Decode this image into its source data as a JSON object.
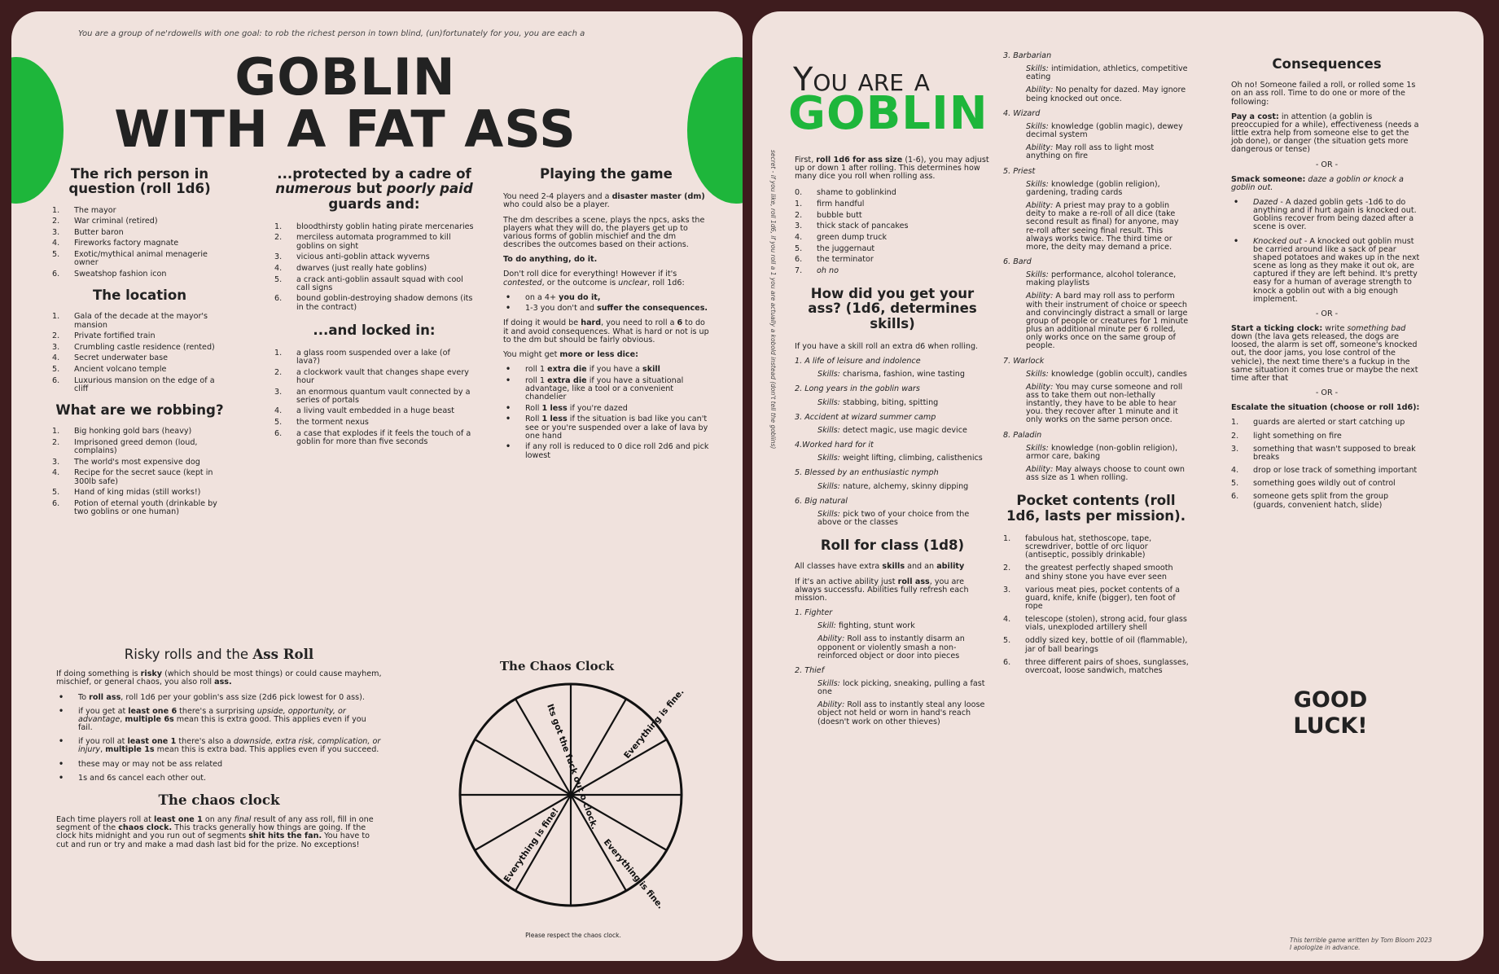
{
  "page1": {
    "intro": "You are a group of ne'rdowells with one goal: to rob the richest person in town blind, (un)fortunately for you, you are each a",
    "title_line1": "GOBLIN",
    "title_line2": "WITH A FAT ASS",
    "rich": {
      "heading": "The rich person in question (roll 1d6)",
      "items": [
        "The mayor",
        "War criminal (retired)",
        "Butter baron",
        "Fireworks factory magnate",
        "Exotic/mythical animal menagerie owner",
        "Sweatshop fashion icon"
      ]
    },
    "location": {
      "heading": "The location",
      "items": [
        "Gala of the decade at the mayor's mansion",
        "Private fortified train",
        "Crumbling castle residence (rented)",
        "Secret underwater base",
        "Ancient volcano temple",
        "Luxurious mansion on the edge of a cliff"
      ]
    },
    "robbing": {
      "heading": "What are we robbing?",
      "items": [
        "Big honking gold bars (heavy)",
        "Imprisoned greed demon (loud, complains)",
        "The world's most expensive dog",
        "Recipe for the secret sauce (kept in 300lb safe)",
        "Hand of king midas (still works!)",
        "Potion of eternal youth (drinkable by two goblins or one human)"
      ]
    },
    "protected": {
      "heading_a": "...protected by a cadre of",
      "heading_b1": "numerous",
      "heading_b2": " but ",
      "heading_b3": "poorly paid",
      "heading_c": "guards and:",
      "items": [
        "bloodthirsty goblin hating pirate mercenaries",
        "merciless automata programmed to kill goblins on sight",
        "vicious anti-goblin attack wyverns",
        "dwarves (just really hate goblins)",
        "a crack anti-goblin assault squad with cool call signs",
        "bound goblin-destroying shadow demons (its in the contract)"
      ]
    },
    "locked": {
      "heading": "...and locked in:",
      "items": [
        "a glass room suspended over a lake (of lava?)",
        "a clockwork vault that changes shape every hour",
        "an enormous quantum vault connected by a series of portals",
        "a living vault embedded in a huge beast",
        "the torment nexus",
        "a case that explodes if it feels the touch of a goblin for more than five seconds"
      ]
    },
    "playing": {
      "heading": "Playing the game",
      "p1a": "You need 2-4 players and a ",
      "p1b": "disaster master (dm)",
      "p1c": " who could also be a player.",
      "p2": "The dm describes a scene, plays the npcs, asks the players what they will do, the players get up to various forms of goblin mischief and the dm describes the outcomes based on their actions.",
      "p3": "To do anything, do it.",
      "p4a": "Don't roll dice for everything! However if it's ",
      "p4b": "contested",
      "p4c": ", or the outcome is ",
      "p4d": "unclear",
      "p4e": ", roll 1d6:",
      "b1a": "on a 4+ ",
      "b1b": "you do it,",
      "b2a": "1-3 you don't and ",
      "b2b": "suffer the consequences.",
      "p5a": "If doing it would be ",
      "p5b": "hard",
      "p5c": ", you need to roll a ",
      "p5d": "6",
      "p5e": " to do it and avoid consequences. What is hard or not is up to the dm but should be fairly obvious.",
      "p6a": "You might get ",
      "p6b": "more or less dice:",
      "d1a": "roll 1 ",
      "d1b": "extra die",
      "d1c": " if you have a ",
      "d1d": "skill",
      "d2a": "roll 1 ",
      "d2b": "extra die",
      "d2c": " if you have a situational advantage, like a tool or a convenient chandelier",
      "d3a": "Roll ",
      "d3b": "1 less",
      "d3c": " if you're dazed",
      "d4a": "Roll ",
      "d4b": "1 less",
      "d4c": " if the situation is bad like you can't see or you're suspended over a lake of lava by one hand",
      "d5": "if any roll is reduced to 0 dice roll 2d6 and pick lowest"
    },
    "risky": {
      "heading_a": "Risky rolls and the ",
      "heading_b": "Ass Roll",
      "p1a": "If doing something is ",
      "p1b": "risky",
      "p1c": " (which should be most things) or could cause mayhem, mischief, or general chaos, you also roll ",
      "p1d": "ass.",
      "b1a": "To ",
      "b1b": "roll ass",
      "b1c": ", roll 1d6 per your goblin's ass size (2d6 pick lowest for 0 ass).",
      "b2a": "if you get at ",
      "b2b": "least one 6",
      "b2c": " there's a surprising ",
      "b2d": "upside, opportunity, or advantage",
      "b2e": ", ",
      "b2f": "multiple 6s",
      "b2g": " mean this is extra good. This applies even if you fail.",
      "b3a": "if you roll at ",
      "b3b": "least one 1",
      "b3c": " there's also a ",
      "b3d": "downside, extra risk, complication, or injury",
      "b3e": ", ",
      "b3f": "multiple 1s",
      "b3g": " mean this is extra bad. This applies even if you succeed.",
      "b4": "these may or may not be ass related",
      "b5": "1s and 6s cancel each other out."
    },
    "chaosclock": {
      "heading": "The chaos clock",
      "p1a": "Each time players roll at ",
      "p1b": "least one 1",
      "p1c": " on any ",
      "p1d": "final",
      "p1e": " result of any ass roll, fill in one segment of the ",
      "p1f": "chaos clock.",
      "p1g": " This tracks generally how things are going. If the clock hits midnight and you run out of segments ",
      "p1h": "shit hits the fan.",
      "p1i": " You have to cut and run or try and make a mad dash last bid for the prize. No exceptions!"
    },
    "clock": {
      "title": "The Chaos Clock",
      "label_top": "Its got the fuck out o clock.",
      "label_right": "Everything is fine.",
      "label_bottom_right": "Everything is fine.",
      "label_bottom_left": "Everything is fine!",
      "caption": "Please respect the chaos clock."
    }
  },
  "page2": {
    "title_line1": "You are a",
    "title_line2": "GOBLIN",
    "side_note": "secret - if you like, roll 1d6, if you roll a 1 you are actually a kobold instead (don't tell the goblins)",
    "asssize": {
      "p1a": "First, ",
      "p1b": "roll 1d6 for ass size",
      "p1c": " (1-6), you may adjust up or down 1 after rolling. This determines how many dice you roll when rolling ass.",
      "items": [
        {
          "n": "0.",
          "t": "shame to goblinkind"
        },
        {
          "n": "1.",
          "t": "firm handful"
        },
        {
          "n": "2.",
          "t": "bubble butt"
        },
        {
          "n": "3.",
          "t": "thick stack of pancakes"
        },
        {
          "n": "4.",
          "t": "green dump truck"
        },
        {
          "n": "5.",
          "t": "the juggernaut"
        },
        {
          "n": "6.",
          "t": "the terminator"
        },
        {
          "n": "7.",
          "t": "oh no"
        }
      ]
    },
    "skills": {
      "heading": "How did you get your ass? (1d6, determines skills)",
      "intro": "If you have a skill roll an extra d6 when rolling.",
      "items": [
        {
          "h": "1. A life of leisure and indolence",
          "s": "charisma, fashion, wine tasting"
        },
        {
          "h": "2. Long years in the goblin wars",
          "s": "stabbing, biting, spitting"
        },
        {
          "h": "3. Accident at wizard summer camp",
          "s": "detect magic, use magic device"
        },
        {
          "h": "4.Worked hard for it",
          "s": "weight lifting, climbing, calisthenics"
        },
        {
          "h": "5. Blessed by an enthusiastic nymph",
          "s": "nature, alchemy, skinny dipping"
        },
        {
          "h": "6. Big natural",
          "s": "pick two of your choice from the above or the classes"
        }
      ],
      "skills_label": "Skills:"
    },
    "class": {
      "heading": "Roll for class (1d8)",
      "p1a": "All classes have extra ",
      "p1b": "skills",
      "p1c": " and an ",
      "p1d": "ability",
      "p2a": "If it's an active ability just ",
      "p2b": "roll ass",
      "p2c": ", you are always successfu. Abilities fully refresh each mission.",
      "skill_label": "Skill:",
      "skills_label": "Skills:",
      "ability_label": "Ability:",
      "items": [
        {
          "h": "1. Fighter",
          "s": "fighting, stunt work",
          "a": "Roll ass to instantly disarm an opponent or violently smash a non-reinforced object or door into pieces"
        },
        {
          "h": "2. Thief",
          "s": "lock picking, sneaking, pulling a fast one",
          "a": "Roll ass to instantly steal any loose object not held or worn in hand's reach (doesn't work on other thieves)"
        },
        {
          "h": "3. Barbarian",
          "s": "intimidation, athletics, competitive eating",
          "a": "No penalty for dazed. May ignore being knocked out once."
        },
        {
          "h": "4. Wizard",
          "s": "knowledge (goblin magic), dewey decimal system",
          "a": "May roll ass to light most anything on fire"
        },
        {
          "h": "5. Priest",
          "s": "knowledge (goblin religion), gardening, trading cards",
          "a": "A priest may pray to a goblin deity to make a re-roll of all dice (take second result as final) for anyone, may re-roll after seeing final result. This always works twice. The third time or more, the deity may demand a price."
        },
        {
          "h": "6. Bard",
          "s": "performance, alcohol tolerance, making playlists",
          "a": "A bard may roll ass to perform with their instrument of choice or speech and convincingly distract a small or large group of people or creatures for 1 minute plus an additional minute per 6 rolled, only works once on the same group of people."
        },
        {
          "h": "7. Warlock",
          "s": "knowledge (goblin occult), candles",
          "a": "You may curse someone and roll ass to take them out non-lethally instantly, they have to be able to hear you. they recover after 1 minute and it only works on the same person once."
        },
        {
          "h": "8. Paladin",
          "s": "knowledge (non-goblin religion), armor care, baking",
          "a": "May always choose to count own ass size as 1 when rolling."
        }
      ]
    },
    "pocket": {
      "heading": "Pocket contents (roll 1d6, lasts per mission).",
      "items": [
        "fabulous hat, stethoscope, tape, screwdriver, bottle of orc liquor (antiseptic, possibly drinkable)",
        "the greatest perfectly shaped smooth and shiny stone you have ever seen",
        "various meat pies, pocket contents of a guard, knife, knife (bigger), ten foot of rope",
        "telescope (stolen), strong acid, four glass vials, unexploded artillery shell",
        "oddly sized key, bottle of oil (flammable), jar of ball bearings",
        "three different pairs of shoes, sunglasses, overcoat, loose sandwich, matches"
      ]
    },
    "consequences": {
      "heading": "Consequences",
      "intro": "Oh no! Someone failed a roll, or rolled some 1s on an ass roll. Time to do one or more of the following:",
      "pay_a": "Pay a cost:",
      "pay_b": " in attention (a goblin is preoccupied for a while), effectiveness (needs a little extra help from someone else to get the job done), or danger (the situation gets more dangerous or tense)",
      "or": "- OR -",
      "smack_a": "Smack someone:",
      "smack_b": " daze a goblin or knock a goblin out.",
      "dazed_a": "Dazed",
      "dazed_b": " - A dazed goblin gets -1d6 to do anything and if hurt again is knocked out. Goblins recover from being dazed after a scene is over.",
      "ko_a": "Knocked out",
      "ko_b": " - A knocked out goblin must be carried around like a sack of pear shaped potatoes and wakes up in the next scene as long as they make it out ok, are captured if they are left behind. It's pretty easy for a human of average strength to knock a goblin out with a big enough implement.",
      "clock_a": "Start a ticking clock:",
      "clock_b": " write ",
      "clock_c": "something bad",
      "clock_d": " down (the lava gets released, the dogs are loosed, the alarm is set off, someone's knocked out, the door jams, you lose control of the vehicle), the next time there's a fuckup in the same situation it comes true or maybe the next time after that",
      "escalate": "Escalate the situation (choose or roll 1d6):",
      "items": [
        "guards are alerted or start catching up",
        "light something on fire",
        "something that wasn't supposed to break breaks",
        "drop or lose track of something important",
        "something goes wildly out of control",
        "someone gets split from the group (guards, convenient hatch, slide)"
      ]
    },
    "good_luck_1": "GOOD",
    "good_luck_2": "LUCK!",
    "credit_1": "This terrible game written by Tom Bloom 2023",
    "credit_2": "I apologize in advance."
  },
  "colors": {
    "background": "#3e1c1e",
    "paper": "#f0e2dd",
    "goblin_green": "#1eb63b",
    "text": "#222222"
  }
}
